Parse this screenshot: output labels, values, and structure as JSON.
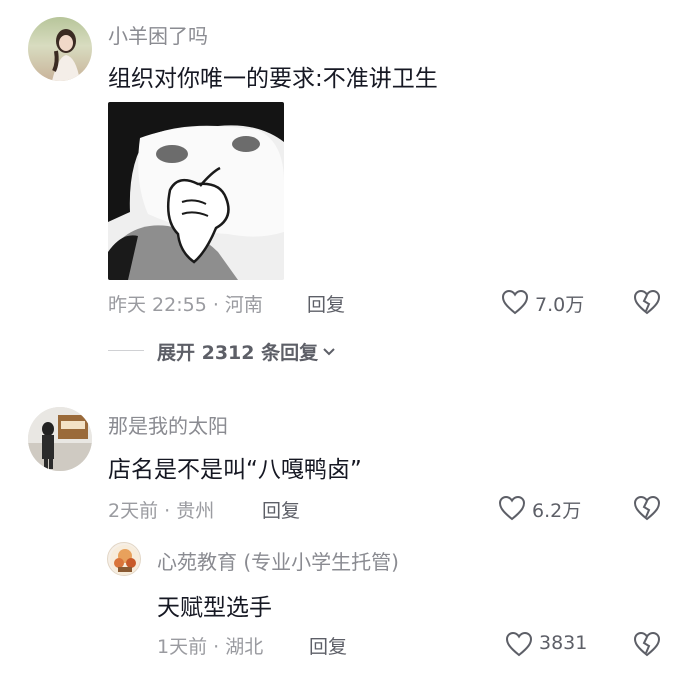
{
  "comments": [
    {
      "username": "小羊困了吗",
      "text": "组织对你唯一的要求:不准讲卫生",
      "meta": "昨天 22:55 · 河南",
      "reply_label": "回复",
      "likes": "7.0万",
      "expand_label": "展开 2312 条回复"
    },
    {
      "username": "那是我的太阳",
      "text": "店名是不是叫“八嘎鸭卤”",
      "meta": "2天前 · 贵州",
      "reply_label": "回复",
      "likes": "6.2万",
      "reply": {
        "username": "心苑教育 (专业小学生托管)",
        "text": "天赋型选手",
        "meta": "1天前 · 湖北",
        "reply_label": "回复",
        "likes": "3831"
      }
    }
  ],
  "colors": {
    "primary_text": "#161823",
    "secondary_text": "#8a8b91",
    "meta_text": "#9a9ba0"
  },
  "icons": [
    "heart-outline-icon",
    "broken-heart-icon",
    "chevron-down-icon"
  ]
}
